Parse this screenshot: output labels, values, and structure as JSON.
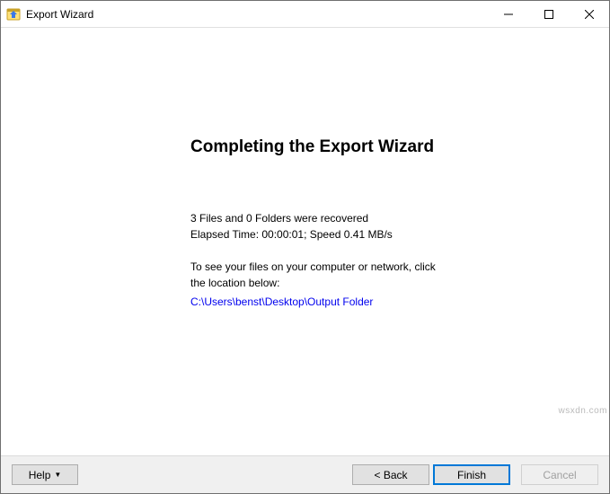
{
  "window": {
    "title": "Export Wizard"
  },
  "content": {
    "heading": "Completing the Export Wizard",
    "summary_line1": "3 Files and 0 Folders were recovered",
    "summary_line2": "Elapsed Time: 00:00:01; Speed 0.41 MB/s",
    "instruction": "To see your files on your computer or network, click the location below:",
    "output_path": "C:\\Users\\benst\\Desktop\\Output Folder"
  },
  "buttons": {
    "help": "Help",
    "back": "< Back",
    "finish": "Finish",
    "cancel": "Cancel"
  },
  "watermark": "wsxdn.com"
}
